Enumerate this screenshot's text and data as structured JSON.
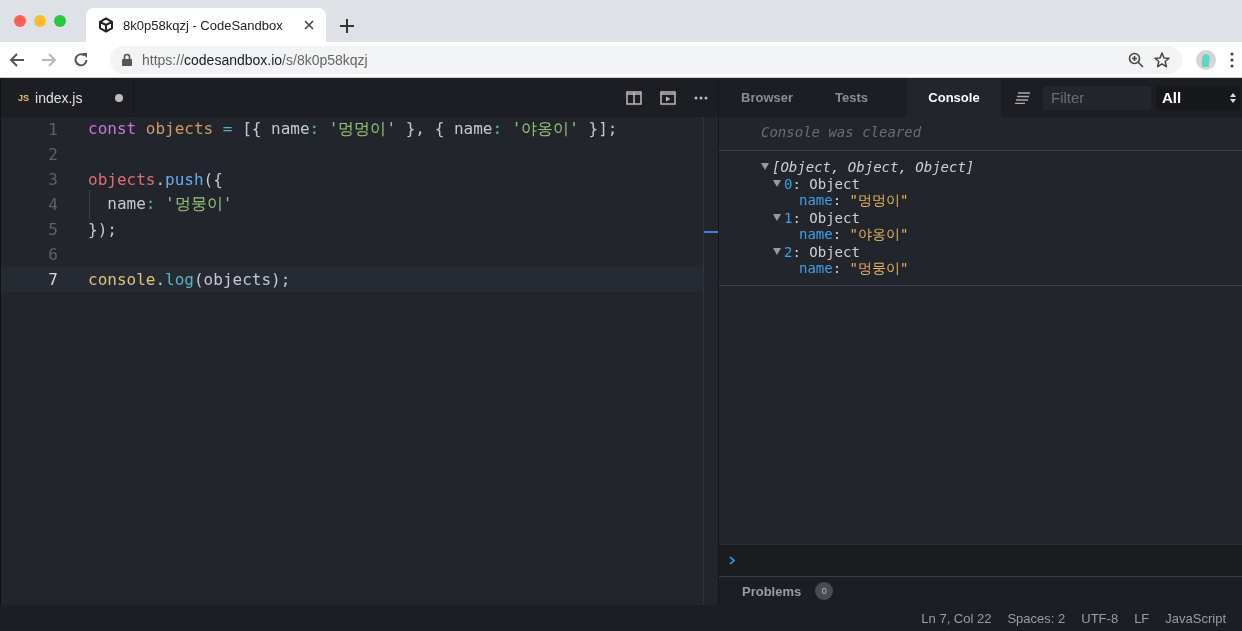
{
  "browser": {
    "tab": {
      "title": "8k0p58kqzj - CodeSandbox"
    },
    "nav": [
      {
        "kind": "back",
        "disabled": false
      },
      {
        "kind": "forward",
        "disabled": true
      },
      {
        "kind": "reload",
        "disabled": false
      }
    ],
    "address": {
      "scheme": "https://",
      "host": "codesandbox.io",
      "path": "/s/8k0p58kqzj"
    }
  },
  "editor": {
    "tabs": [
      {
        "badge": "JS",
        "label": "index.js",
        "modified": true
      }
    ],
    "lines": [
      {
        "number": "1",
        "current": false,
        "tokens": [
          {
            "kind": "keyword",
            "text": "const "
          },
          {
            "kind": "variable",
            "text": "objects "
          },
          {
            "kind": "operator",
            "text": "= "
          },
          {
            "kind": "plain",
            "text": "[{ name"
          },
          {
            "kind": "operator",
            "text": ": "
          },
          {
            "kind": "string",
            "text": "'멍멍이'"
          },
          {
            "kind": "plain",
            "text": " }, { name"
          },
          {
            "kind": "operator",
            "text": ": "
          },
          {
            "kind": "string",
            "text": "'야옹이'"
          },
          {
            "kind": "plain",
            "text": " }];"
          }
        ]
      },
      {
        "number": "2",
        "current": false
      },
      {
        "number": "3",
        "current": false,
        "tokens": [
          {
            "kind": "object",
            "text": "objects"
          },
          {
            "kind": "plain",
            "text": "."
          },
          {
            "kind": "method",
            "text": "push"
          },
          {
            "kind": "plain",
            "text": "({"
          }
        ]
      },
      {
        "number": "4",
        "current": false,
        "tokens": [
          {
            "kind": "plain",
            "text": "  name"
          },
          {
            "kind": "operator",
            "text": ": "
          },
          {
            "kind": "string",
            "text": "'멍뭉이'"
          }
        ]
      },
      {
        "number": "5",
        "current": false,
        "tokens": [
          {
            "kind": "plain",
            "text": "});"
          }
        ]
      },
      {
        "number": "6",
        "current": false
      },
      {
        "number": "7",
        "current": true,
        "tokens": [
          {
            "kind": "global",
            "text": "console"
          },
          {
            "kind": "plain",
            "text": "."
          },
          {
            "kind": "function",
            "text": "log"
          },
          {
            "kind": "plain",
            "text": "(objects);"
          }
        ]
      }
    ]
  },
  "preview": {
    "tabs": [
      {
        "label": "Browser",
        "selected": false
      },
      {
        "label": "Tests",
        "selected": false
      },
      {
        "label": "Console",
        "selected": true
      }
    ],
    "filter": {
      "placeholder": "Filter"
    },
    "level_select": {
      "value": "All"
    },
    "console": {
      "notice": "Console was cleared",
      "entries": [
        {
          "summary": "[Object, Object, Object]",
          "expanded": true,
          "children": [
            {
              "key": "0",
              "sep": ":",
              "type": "Object",
              "expanded": true,
              "children": [
                {
                  "key": "name",
                  "sep": ":",
                  "value": "\"멍멍이\""
                }
              ]
            },
            {
              "key": "1",
              "sep": ":",
              "type": "Object",
              "expanded": true,
              "children": [
                {
                  "key": "name",
                  "sep": ":",
                  "value": "\"야옹이\""
                }
              ]
            },
            {
              "key": "2",
              "sep": ":",
              "type": "Object",
              "expanded": true,
              "children": [
                {
                  "key": "name",
                  "sep": ":",
                  "value": "\"멍뭉이\""
                }
              ]
            }
          ]
        }
      ]
    },
    "problems": {
      "label": "Problems",
      "count": "0"
    }
  },
  "status_bar": {
    "items": [
      "Ln 7, Col 22",
      "Spaces: 2",
      "UTF-8",
      "LF",
      "JavaScript"
    ]
  }
}
